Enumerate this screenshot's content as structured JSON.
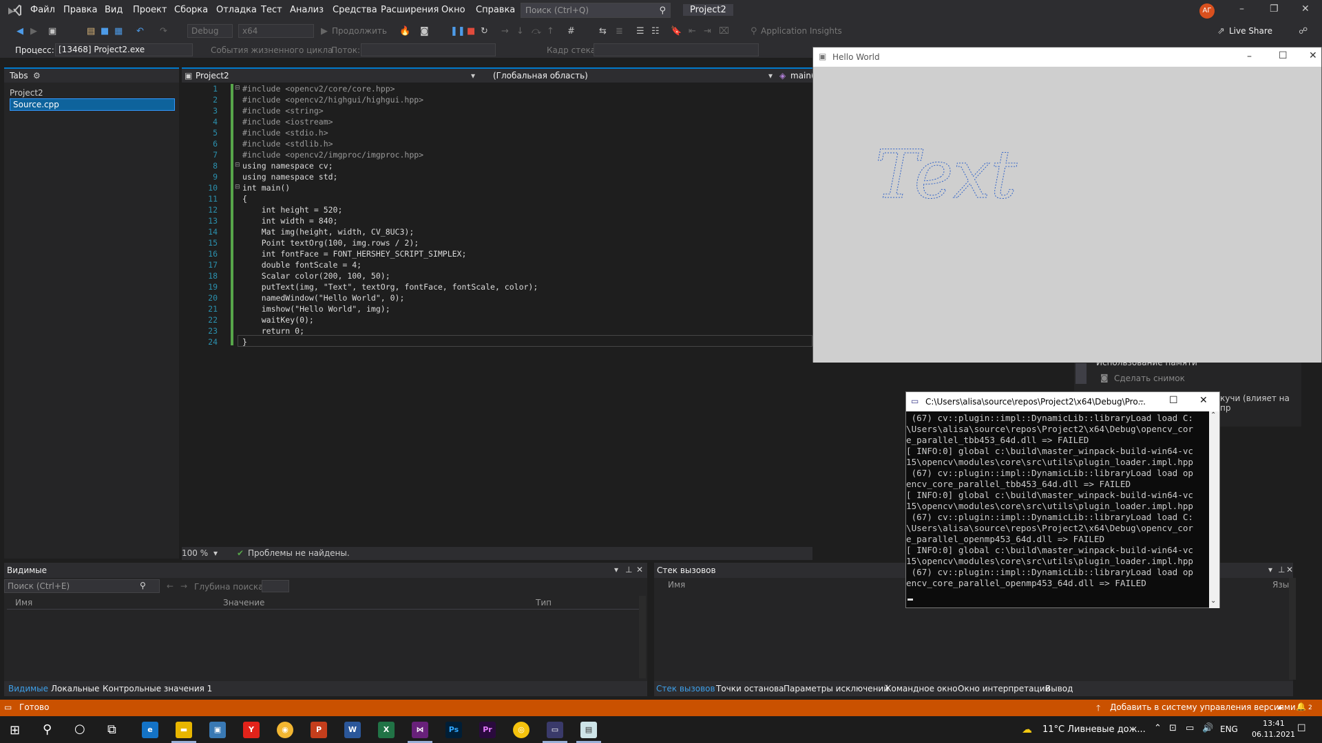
{
  "menubar": {
    "items": [
      "Файл",
      "Правка",
      "Вид",
      "Проект",
      "Сборка",
      "Отладка",
      "Тест",
      "Анализ",
      "Средства",
      "Расширения",
      "Окно",
      "Справка"
    ],
    "search_placeholder": "Поиск (Ctrl+Q)",
    "project_name": "Project2",
    "avatar_initials": "АГ"
  },
  "toolbar": {
    "config": "Debug",
    "platform": "x64",
    "continue_label": "Продолжить",
    "app_insights": "Application Insights",
    "live_share": "Live Share"
  },
  "procbar": {
    "process_label": "Процесс:",
    "process_value": "[13468] Project2.exe",
    "lifecycle_label": "События жизненного цикла",
    "thread_label": "Поток:",
    "frame_label": "Кадр стека:"
  },
  "tabs_panel": {
    "title": "Tabs",
    "project": "Project2",
    "file": "Source.cpp"
  },
  "editor": {
    "project_combo": "Project2",
    "scope_combo": "(Глобальная область)",
    "func_combo": "main(",
    "zoom": "100 %",
    "problems": "Проблемы не найдены.",
    "lines": [
      "#include <opencv2/core/core.hpp>",
      "#include <opencv2/highgui/highgui.hpp>",
      "#include <string>",
      "#include <iostream>",
      "#include <stdio.h>",
      "#include <stdlib.h>",
      "#include <opencv2/imgproc/imgproc.hpp>",
      "using namespace cv;",
      "using namespace std;",
      "int main()",
      "{",
      "    int height = 520;",
      "    int width = 840;",
      "    Mat img(height, width, CV_8UC3);",
      "    Point textOrg(100, img.rows / 2);",
      "    int fontFace = FONT_HERSHEY_SCRIPT_SIMPLEX;",
      "    double fontScale = 4;",
      "    Scalar color(200, 100, 50);",
      "    putText(img, \"Text\", textOrg, fontFace, fontScale, color);",
      "    namedWindow(\"Hello World\", 0);",
      "    imshow(\"Hello World\", img);",
      "    waitKey(0);",
      "    return 0;",
      "}"
    ]
  },
  "vis_panel": {
    "title": "Видимые",
    "search_placeholder": "Поиск (Ctrl+E)",
    "depth_label": "Глубина поиска:",
    "columns": [
      "Имя",
      "Значение",
      "Тип"
    ],
    "tabs": [
      "Видимые",
      "Локальные",
      "Контрольные значения 1"
    ]
  },
  "stack_panel": {
    "title": "Стек вызовов",
    "columns": [
      "Имя",
      "Язык"
    ],
    "tabs": [
      "Стек вызовов",
      "Точки останова",
      "Параметры исключений",
      "Командное окно",
      "Окно интерпретации",
      "Вывод"
    ]
  },
  "diag_panel": {
    "memory": "Использование памяти",
    "snapshot": "Сделать снимок",
    "heap": "кучи (влияет на пр"
  },
  "statusbar": {
    "ready": "Готово",
    "vcs": "Добавить в систему управления версиями",
    "notif_count": "2"
  },
  "hello_window": {
    "title": "Hello World",
    "text": "Text",
    "text_color": "#3264c8"
  },
  "console": {
    "title": "C:\\Users\\alisa\\source\\repos\\Project2\\x64\\Debug\\Pro...",
    "lines": [
      " (67) cv::plugin::impl::DynamicLib::libraryLoad load C:",
      "\\Users\\alisa\\source\\repos\\Project2\\x64\\Debug\\opencv_cor",
      "e_parallel_tbb453_64d.dll => FAILED",
      "[ INFO:0] global c:\\build\\master_winpack-build-win64-vc",
      "15\\opencv\\modules\\core\\src\\utils\\plugin_loader.impl.hpp",
      " (67) cv::plugin::impl::DynamicLib::libraryLoad load op",
      "encv_core_parallel_tbb453_64d.dll => FAILED",
      "[ INFO:0] global c:\\build\\master_winpack-build-win64-vc",
      "15\\opencv\\modules\\core\\src\\utils\\plugin_loader.impl.hpp",
      " (67) cv::plugin::impl::DynamicLib::libraryLoad load C:",
      "\\Users\\alisa\\source\\repos\\Project2\\x64\\Debug\\opencv_cor",
      "e_parallel_openmp453_64d.dll => FAILED",
      "[ INFO:0] global c:\\build\\master_winpack-build-win64-vc",
      "15\\opencv\\modules\\core\\src\\utils\\plugin_loader.impl.hpp",
      " (67) cv::plugin::impl::DynamicLib::libraryLoad load op",
      "encv_core_parallel_openmp453_64d.dll => FAILED"
    ]
  },
  "taskbar": {
    "weather": "11°C  Ливневые дож...",
    "lang": "ENG",
    "time": "13:41",
    "date": "06.11.2021"
  }
}
